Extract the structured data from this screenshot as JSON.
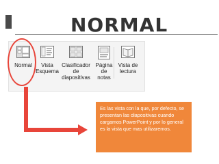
{
  "page": {
    "title": "NORMAL"
  },
  "ribbon": {
    "views": [
      {
        "id": "normal",
        "label": "Normal",
        "icon": "normal-view-icon"
      },
      {
        "id": "outline",
        "label": "Vista Esquema",
        "icon": "outline-view-icon"
      },
      {
        "id": "sorter",
        "label": "Clasificador de diapositivas",
        "icon": "slide-sorter-icon"
      },
      {
        "id": "notes",
        "label": "Página de notas",
        "icon": "notes-page-icon"
      },
      {
        "id": "reading",
        "label": "Vista de lectura",
        "icon": "reading-view-icon"
      }
    ]
  },
  "description": "Es las vista con la que, por defecto, se presentan las diapositivas cuando cargamos PowerPoint y por lo general es la vista que mas utilizaremos.",
  "colors": {
    "accent": "#e8453a",
    "box": "#f0873a",
    "title": "#333333"
  }
}
